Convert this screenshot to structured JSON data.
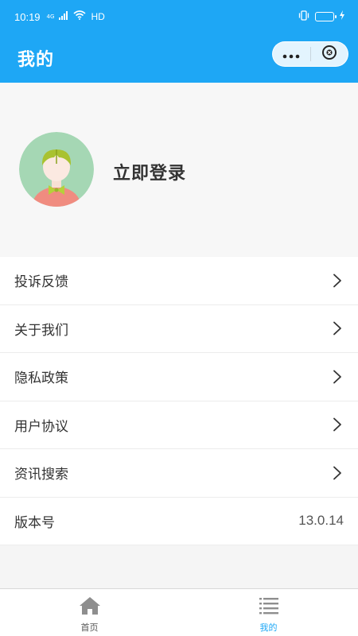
{
  "status_bar": {
    "time": "10:19",
    "network": "4G",
    "hd": "HD",
    "icons": [
      "signal-icon",
      "wifi-icon",
      "vibrate-icon",
      "battery-icon",
      "charging-icon"
    ]
  },
  "navbar": {
    "title": "我的",
    "capsule": {
      "more_icon": "more-dots-icon",
      "close_icon": "close-circle-icon"
    },
    "color": "#1ea7f5"
  },
  "profile": {
    "avatar_icon": "user-avatar-icon",
    "login_text": "立即登录"
  },
  "menu": {
    "items": [
      {
        "label": "投诉反馈",
        "icon": "chevron-right-icon"
      },
      {
        "label": "关于我们",
        "icon": "chevron-right-icon"
      },
      {
        "label": "隐私政策",
        "icon": "chevron-right-icon"
      },
      {
        "label": "用户协议",
        "icon": "chevron-right-icon"
      },
      {
        "label": "资讯搜索",
        "icon": "chevron-right-icon"
      }
    ],
    "version": {
      "label": "版本号",
      "value": "13.0.14"
    }
  },
  "tabbar": {
    "tabs": [
      {
        "label": "首页",
        "icon": "home-icon",
        "active": false
      },
      {
        "label": "我的",
        "icon": "list-icon",
        "active": true
      }
    ],
    "active_color": "#1ea7f5",
    "inactive_color": "#555555"
  }
}
